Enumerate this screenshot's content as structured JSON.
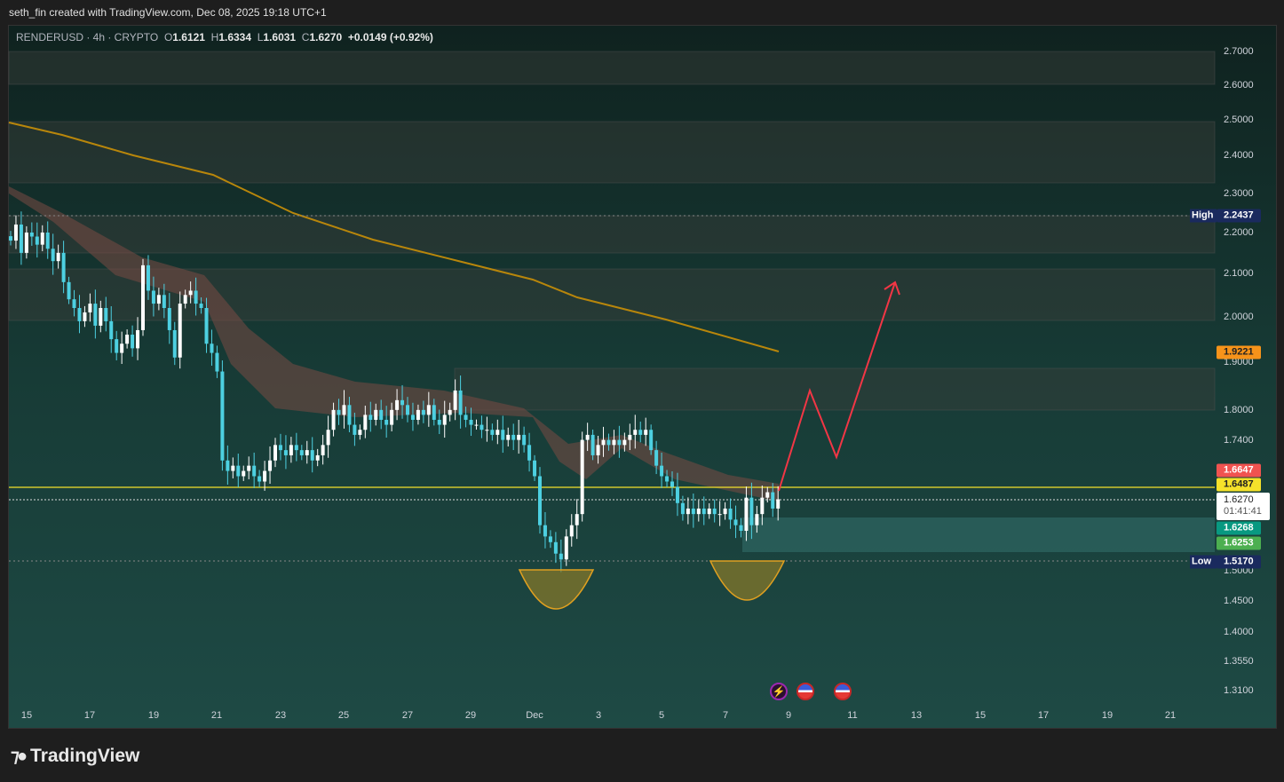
{
  "caption": "seth_fin created with TradingView.com, Dec 08, 2025 19:18 UTC+1",
  "legend": {
    "symbol": "RENDERUSD · 4h · CRYPTO",
    "o_label": "O",
    "o": "1.6121",
    "h_label": "H",
    "h": "1.6334",
    "l_label": "L",
    "l": "1.6031",
    "c_label": "C",
    "c": "1.6270",
    "change": "+0.0149 (+0.92%)"
  },
  "price_axis": [
    "2.7000",
    "2.6000",
    "2.5000",
    "2.4000",
    "2.3000",
    "2.2000",
    "2.1000",
    "2.0000",
    "1.9000",
    "1.8000",
    "1.7400",
    "1.5000",
    "1.4500",
    "1.4000",
    "1.3550",
    "1.3100"
  ],
  "tags": {
    "ema": "1.9221",
    "red": "1.6647",
    "yellow": "1.6487",
    "last": "1.6270",
    "countdown": "01:41:41",
    "teal": "1.6268",
    "green": "1.6253",
    "high_label": "High",
    "high": "2.2437",
    "low_label": "Low",
    "low": "1.5170"
  },
  "x_axis": [
    "15",
    "17",
    "19",
    "21",
    "23",
    "25",
    "27",
    "29",
    "Dec",
    "3",
    "5",
    "7",
    "9",
    "11",
    "13",
    "15",
    "17",
    "19",
    "21"
  ],
  "logo": "TradingView",
  "colors": {
    "up": "#ffffff",
    "down": "#4dd0e1",
    "arrow": "#f23645",
    "ema": "#b8860b",
    "level": "#f5e12a"
  },
  "chart_data": {
    "type": "candlestick",
    "symbol": "RENDERUSD",
    "interval": "4h",
    "scale": "log",
    "ylim": [
      1.28,
      2.75
    ],
    "closes": [
      2.18,
      2.22,
      2.15,
      2.2,
      2.19,
      2.17,
      2.2,
      2.16,
      2.13,
      2.15,
      2.08,
      2.04,
      2.02,
      1.99,
      2.01,
      2.03,
      1.98,
      2.02,
      1.99,
      1.95,
      1.92,
      1.94,
      1.96,
      1.93,
      1.97,
      2.12,
      2.06,
      2.03,
      2.05,
      2.02,
      1.97,
      1.91,
      2.03,
      2.05,
      2.06,
      2.03,
      2.02,
      1.94,
      1.92,
      1.88,
      1.7,
      1.68,
      1.69,
      1.67,
      1.68,
      1.69,
      1.67,
      1.66,
      1.68,
      1.7,
      1.73,
      1.72,
      1.71,
      1.73,
      1.72,
      1.71,
      1.72,
      1.7,
      1.71,
      1.73,
      1.76,
      1.8,
      1.79,
      1.81,
      1.77,
      1.75,
      1.76,
      1.79,
      1.78,
      1.8,
      1.78,
      1.77,
      1.8,
      1.82,
      1.81,
      1.79,
      1.78,
      1.8,
      1.79,
      1.81,
      1.78,
      1.77,
      1.79,
      1.8,
      1.84,
      1.79,
      1.78,
      1.77,
      1.77,
      1.76,
      1.76,
      1.75,
      1.76,
      1.74,
      1.75,
      1.74,
      1.75,
      1.73,
      1.7,
      1.67,
      1.58,
      1.56,
      1.55,
      1.53,
      1.52,
      1.56,
      1.58,
      1.6,
      1.74,
      1.75,
      1.71,
      1.73,
      1.74,
      1.73,
      1.74,
      1.73,
      1.74,
      1.75,
      1.76,
      1.75,
      1.76,
      1.72,
      1.69,
      1.67,
      1.66,
      1.65,
      1.62,
      1.6,
      1.61,
      1.6,
      1.61,
      1.6,
      1.61,
      1.6,
      1.6,
      1.61,
      1.59,
      1.58,
      1.57,
      1.63,
      1.58,
      1.6,
      1.63,
      1.64,
      1.61,
      1.627
    ]
  }
}
